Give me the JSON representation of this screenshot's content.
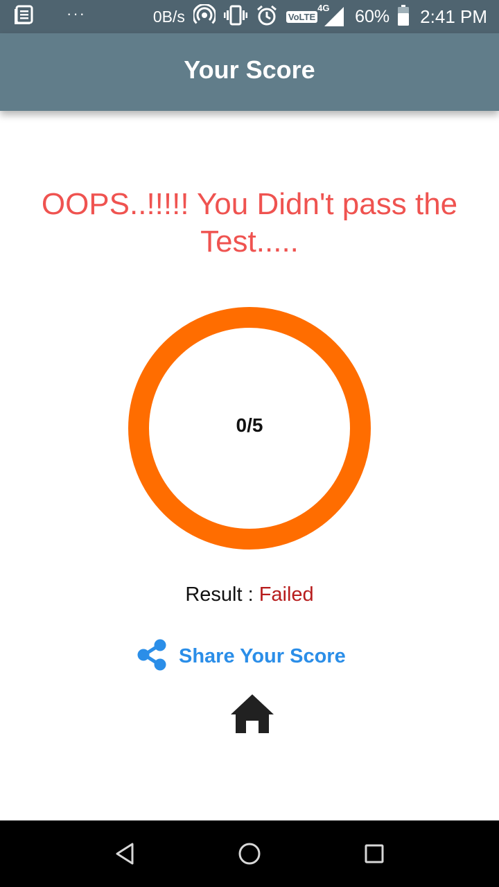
{
  "status_bar": {
    "net_speed": "0B/s",
    "volte": "VoLTE",
    "network_type": "4G",
    "battery": "60%",
    "time": "2:41 PM"
  },
  "app_bar": {
    "title": "Your Score"
  },
  "message": "OOPS..!!!!! You Didn't pass the Test.....",
  "score": {
    "text": "0/5",
    "progress_fraction": 0,
    "ring_color": "#ff6d00"
  },
  "result": {
    "label": "Result : ",
    "value": "Failed"
  },
  "share": {
    "label": "Share Your Score"
  },
  "icons": {
    "status": [
      "news-icon",
      "more-dots-icon",
      "hotspot-icon",
      "vibrate-icon",
      "alarm-icon",
      "signal-icon",
      "battery-icon"
    ],
    "actions": [
      "share-icon",
      "home-icon"
    ],
    "nav": [
      "back-icon",
      "home-circle-icon",
      "recents-icon"
    ]
  },
  "colors": {
    "status_bar": "#4f6470",
    "app_bar": "#617d8a",
    "headline": "#ef5350",
    "failed": "#b71c1c",
    "share": "#2b8ee8"
  }
}
